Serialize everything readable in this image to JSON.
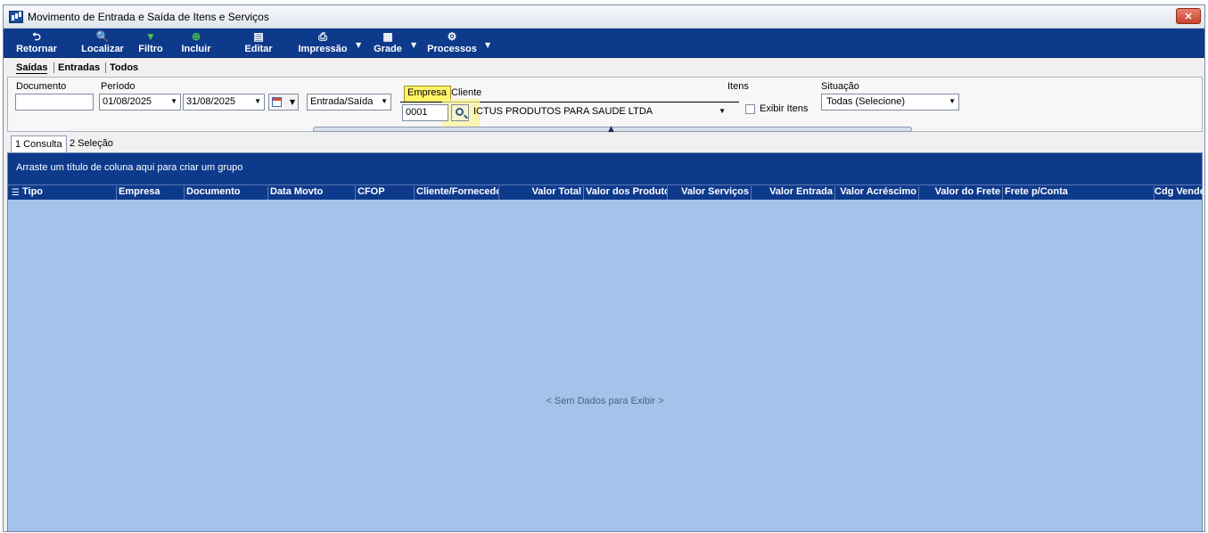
{
  "window": {
    "title": "Movimento de Entrada e Saída de Itens e Serviços",
    "close_label": "×"
  },
  "toolbar": {
    "buttons": [
      {
        "label": "Retornar",
        "icon": "return-arrow-icon",
        "glyph": "⮌"
      },
      {
        "label": "Localizar",
        "icon": "magnifier-icon",
        "glyph": "🔍"
      },
      {
        "label": "Filtro",
        "icon": "funnel-icon",
        "glyph": "▼"
      },
      {
        "label": "Incluir",
        "icon": "add-circle-icon",
        "glyph": "⊕"
      },
      {
        "label": "Editar",
        "icon": "edit-document-icon",
        "glyph": "▤"
      },
      {
        "label": "Impressão",
        "icon": "printer-icon",
        "glyph": "⎙"
      },
      {
        "label": "Grade",
        "icon": "grid-icon",
        "glyph": "▦"
      },
      {
        "label": "Processos",
        "icon": "gear-icon",
        "glyph": "⚙"
      }
    ],
    "caret": "▼"
  },
  "subtabs": [
    {
      "label": "Saídas",
      "active": true
    },
    {
      "label": "Entradas",
      "active": false
    },
    {
      "label": "Todos",
      "active": false
    }
  ],
  "filters": {
    "documento_label": "Documento",
    "documento_value": "",
    "periodo_label": "Período",
    "date_start": "01/08/2025",
    "date_end": "31/08/2025",
    "entrada_saida": "Entrada/Saída",
    "empresa_label": "Empresa",
    "empresa_value": "0001",
    "cliente_label": "Cliente",
    "cliente_value": "ICTUS PRODUTOS PARA SAUDE LTDA",
    "itens_label": "Itens",
    "exibir_itens_label": "Exibir Itens",
    "situacao_label": "Situação",
    "situacao_value": "Todas (Selecione)"
  },
  "view_tabs": [
    {
      "label": "1 Consulta",
      "active": true
    },
    {
      "label": "2 Seleção",
      "active": false
    }
  ],
  "grid": {
    "group_hint": "Arraste um título de coluna aqui para criar um grupo",
    "columns": [
      "Tipo",
      "Empresa",
      "Documento",
      "Data Movto",
      "CFOP",
      "Cliente/Fornecedor",
      "Valor Total",
      "Valor dos Produtos",
      "Valor Serviços",
      "Valor Entrada",
      "Valor Acréscimo",
      "Valor do Frete",
      "Frete p/Conta",
      "Cdg Vendedor"
    ],
    "empty_text": "< Sem Dados para Exibir >"
  },
  "colors": {
    "toolbar_bg": "#0e3a8c",
    "grid_bg": "#a5c3ea",
    "highlight": "#fff36a"
  }
}
